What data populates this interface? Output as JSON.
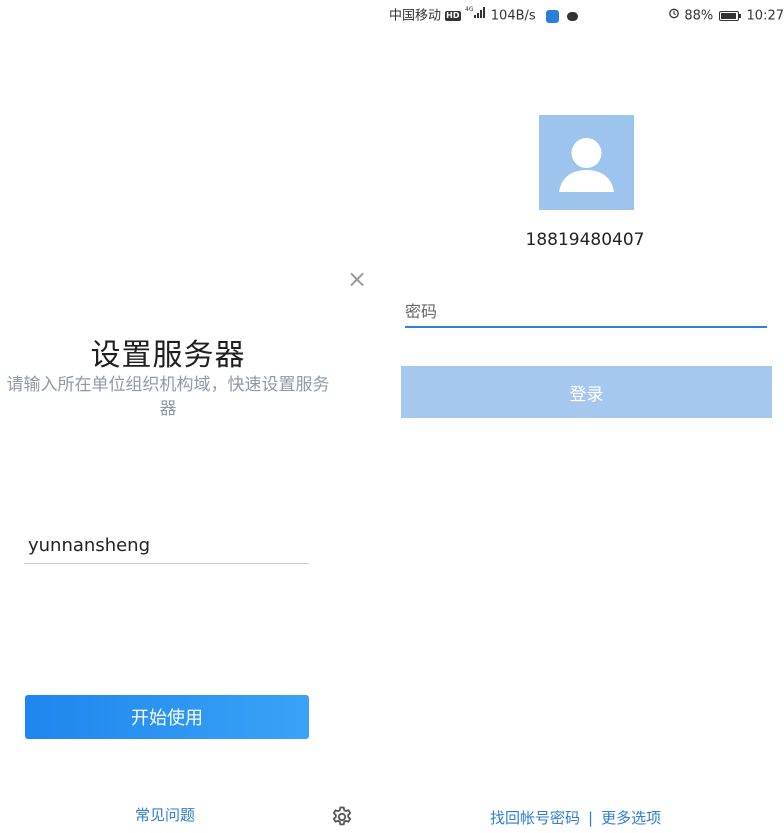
{
  "left": {
    "close_icon": "close-icon",
    "title": "设置服务器",
    "subtitle": "请输入所在单位组织机构域，快速设置服务器",
    "org_input_value": "yunnansheng",
    "start_button": "开始使用",
    "faq_link": "常见问题",
    "settings_icon": "gear-icon",
    "accent_color": "#2d7ed6"
  },
  "status_bar": {
    "carrier": "中国移动",
    "network": "4G",
    "speed": "104B/s",
    "battery": "88%",
    "time": "10:27"
  },
  "right": {
    "avatar_icon": "user-avatar-icon",
    "phone": "18819480407",
    "password_placeholder": "密码",
    "login_button": "登录",
    "recover_link": "找回帐号密码",
    "separator": "|",
    "more_options_link": "更多选项",
    "login_button_color": "#a6c8ee"
  }
}
